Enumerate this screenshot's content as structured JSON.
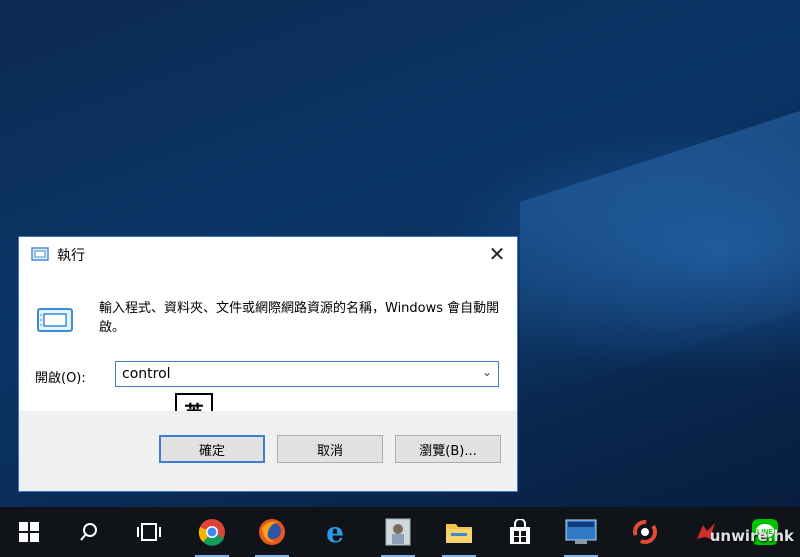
{
  "dialog": {
    "title": "執行",
    "description": "輸入程式、資料夾、文件或網際網路資源的名稱，Windows 會自動開啟。",
    "open_label": "開啟(O):",
    "open_value": "control",
    "ime_indicator": "英",
    "buttons": {
      "ok": "確定",
      "cancel": "取消",
      "browse": "瀏覽(B)..."
    }
  },
  "taskbar": {
    "items": [
      "windows-start-icon",
      "search-icon",
      "task-view-icon",
      "chrome-icon",
      "firefox-icon",
      "internet-explorer-icon",
      "app-portrait-icon",
      "file-explorer-icon",
      "store-icon",
      "lenovo-icon",
      "app-circle-icon",
      "app-red-icon",
      "line-icon"
    ]
  },
  "watermark": "unwire.hk"
}
